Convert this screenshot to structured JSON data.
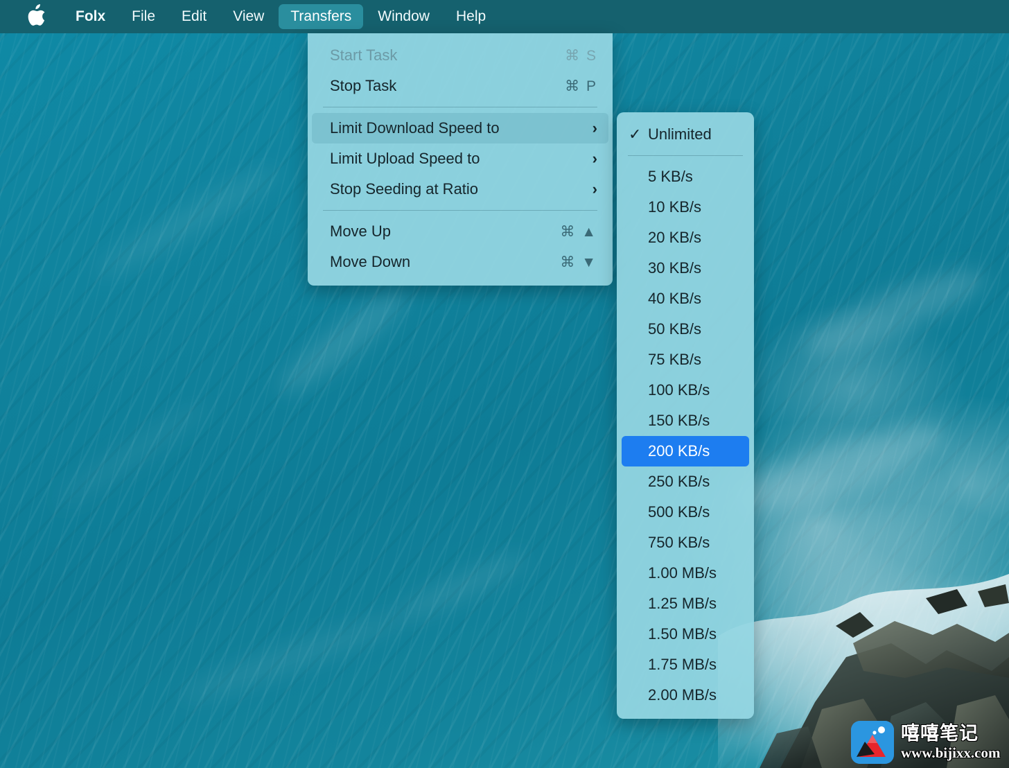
{
  "colors": {
    "menubar_bg": "#15616e",
    "menubar_active": "#2a8e9e",
    "menu_panel_bg": "#94d6e2",
    "selection_blue": "#1d7df0",
    "ocean": "#10839d",
    "text_primary": "#15252b",
    "text_disabled": "#6c9aa6"
  },
  "menubar": {
    "apple_icon": "apple-logo-icon",
    "apple_glyph": "",
    "items": [
      {
        "label": "Folx",
        "active": false,
        "bold": true
      },
      {
        "label": "File",
        "active": false,
        "bold": false
      },
      {
        "label": "Edit",
        "active": false,
        "bold": false
      },
      {
        "label": "View",
        "active": false,
        "bold": false
      },
      {
        "label": "Transfers",
        "active": true,
        "bold": false
      },
      {
        "label": "Window",
        "active": false,
        "bold": false
      },
      {
        "label": "Help",
        "active": false,
        "bold": false
      }
    ]
  },
  "transfers_menu": {
    "title": "Transfers",
    "items": [
      {
        "label": "Start Task",
        "shortcut": "⌘ S",
        "disabled": true,
        "submenu": false,
        "highlighted": false
      },
      {
        "label": "Stop Task",
        "shortcut": "⌘ P",
        "disabled": false,
        "submenu": false,
        "highlighted": false
      },
      {
        "separator": true
      },
      {
        "label": "Limit Download Speed to",
        "shortcut": "",
        "disabled": false,
        "submenu": true,
        "highlighted": true
      },
      {
        "label": "Limit Upload Speed to",
        "shortcut": "",
        "disabled": false,
        "submenu": true,
        "highlighted": false
      },
      {
        "label": "Stop Seeding at Ratio",
        "shortcut": "",
        "disabled": false,
        "submenu": true,
        "highlighted": false
      },
      {
        "separator": true
      },
      {
        "label": "Move Up",
        "shortcut": "⌘ ▲",
        "disabled": false,
        "submenu": false,
        "highlighted": false
      },
      {
        "label": "Move Down",
        "shortcut": "⌘ ▼",
        "disabled": false,
        "submenu": false,
        "highlighted": false
      }
    ]
  },
  "speed_submenu": {
    "title": "Limit Download Speed to",
    "items": [
      {
        "label": "Unlimited",
        "checked": true,
        "selected": false
      },
      {
        "separator": true
      },
      {
        "label": "5 KB/s",
        "checked": false,
        "selected": false
      },
      {
        "label": "10 KB/s",
        "checked": false,
        "selected": false
      },
      {
        "label": "20 KB/s",
        "checked": false,
        "selected": false
      },
      {
        "label": "30 KB/s",
        "checked": false,
        "selected": false
      },
      {
        "label": "40 KB/s",
        "checked": false,
        "selected": false
      },
      {
        "label": "50 KB/s",
        "checked": false,
        "selected": false
      },
      {
        "label": "75 KB/s",
        "checked": false,
        "selected": false
      },
      {
        "label": "100 KB/s",
        "checked": false,
        "selected": false
      },
      {
        "label": "150 KB/s",
        "checked": false,
        "selected": false
      },
      {
        "label": "200 KB/s",
        "checked": false,
        "selected": true
      },
      {
        "label": "250 KB/s",
        "checked": false,
        "selected": false
      },
      {
        "label": "500 KB/s",
        "checked": false,
        "selected": false
      },
      {
        "label": "750 KB/s",
        "checked": false,
        "selected": false
      },
      {
        "label": "1.00 MB/s",
        "checked": false,
        "selected": false
      },
      {
        "label": "1.25 MB/s",
        "checked": false,
        "selected": false
      },
      {
        "label": "1.50 MB/s",
        "checked": false,
        "selected": false
      },
      {
        "label": "1.75 MB/s",
        "checked": false,
        "selected": false
      },
      {
        "label": "2.00 MB/s",
        "checked": false,
        "selected": false
      }
    ],
    "check_glyph": "✓",
    "submenu_arrow_glyph": "›"
  },
  "watermark": {
    "brand_cn": "嘻嘻笔记",
    "url": "www.bijixx.com",
    "logo_icon": "mountain-photo-logo-icon"
  }
}
